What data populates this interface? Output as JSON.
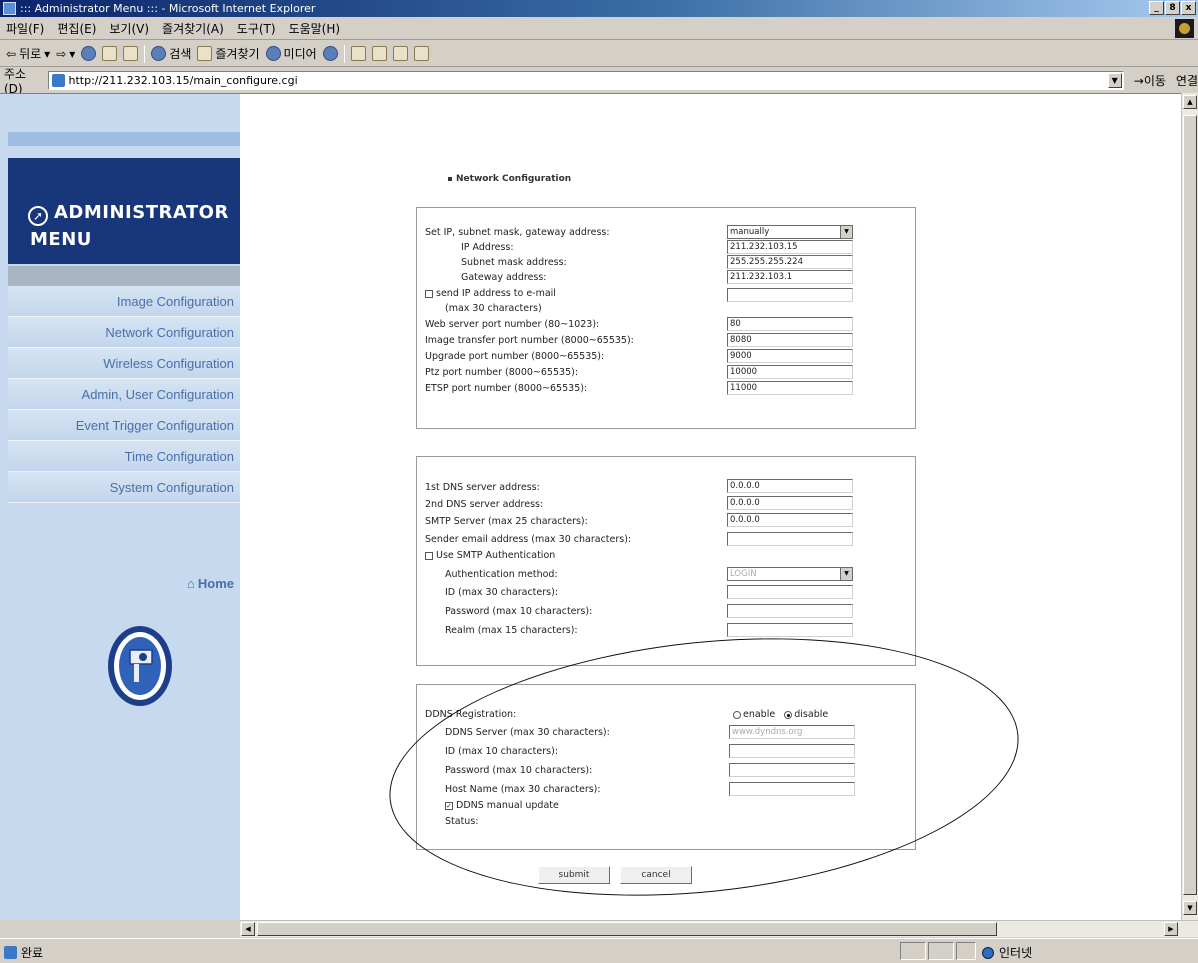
{
  "window": {
    "title": "::: Administrator Menu ::: - Microsoft Internet Explorer",
    "buttons": [
      "_",
      "8",
      "x"
    ]
  },
  "menubar": {
    "items": [
      "파일(F)",
      "편집(E)",
      "보기(V)",
      "즐겨찾기(A)",
      "도구(T)",
      "도움말(H)"
    ]
  },
  "toolbar": {
    "back": "뒤로",
    "search": "검색",
    "favorites": "즐겨찾기",
    "media": "미디어"
  },
  "address": {
    "label": "주소(D)",
    "url": "http://211.232.103.15/main_configure.cgi",
    "go": "이동",
    "links": "연결"
  },
  "sidebar": {
    "header_line1": "ADMINISTRATOR",
    "header_line2": "MENU",
    "items": [
      {
        "label": "Image Configuration"
      },
      {
        "label": "Network Configuration"
      },
      {
        "label": "Wireless Configuration"
      },
      {
        "label": "Admin, User Configuration"
      },
      {
        "label": "Event Trigger Configuration"
      },
      {
        "label": "Time Configuration"
      },
      {
        "label": "System Configuration"
      }
    ],
    "home": "Home"
  },
  "network": {
    "section_title": "Network Configuration",
    "set_ip_label": "Set IP, subnet mask, gateway address:",
    "set_ip_mode": "manually",
    "ip_label": "IP Address:",
    "ip_value": "211.232.103.15",
    "subnet_label": "Subnet mask address:",
    "subnet_value": "255.255.255.224",
    "gateway_label": "Gateway address:",
    "gateway_value": "211.232.103.1",
    "send_ip_label": "send IP address to e-mail",
    "send_ip_note": "(max 30 characters)",
    "web_port_label": "Web server port number (80~1023):",
    "web_port_value": "80",
    "image_port_label": "Image transfer port number (8000~65535):",
    "image_port_value": "8080",
    "upgrade_port_label": "Upgrade port number (8000~65535):",
    "upgrade_port_value": "9000",
    "ptz_port_label": "Ptz port number (8000~65535):",
    "ptz_port_value": "10000",
    "etsp_port_label": "ETSP port number (8000~65535):",
    "etsp_port_value": "11000"
  },
  "dns": {
    "dns1_label": "1st DNS server address:",
    "dns1_value": "0.0.0.0",
    "dns2_label": "2nd DNS server address:",
    "dns2_value": "0.0.0.0",
    "smtp_label": "SMTP Server (max 25 characters):",
    "smtp_value": "0.0.0.0",
    "sender_label": "Sender email address (max 30 characters):",
    "sender_value": "",
    "use_auth_label": "Use SMTP Authentication",
    "auth_method_label": "Authentication method:",
    "auth_method_value": "LOGIN",
    "id_label": "ID (max 30 characters):",
    "password_label": "Password (max 10 characters):",
    "realm_label": "Realm (max 15 characters):"
  },
  "ddns": {
    "registration_label": "DDNS Registration:",
    "enable_label": "enable",
    "disable_label": "disable",
    "server_label": "DDNS Server (max 30 characters):",
    "server_value": "www.dyndns.org",
    "id_label": "ID (max 10 characters):",
    "password_label": "Password (max 10 characters):",
    "host_label": "Host Name (max 30 characters):",
    "manual_update_label": "DDNS manual update",
    "status_label": "Status:"
  },
  "buttons": {
    "submit": "submit",
    "cancel": "cancel"
  },
  "status": {
    "left": "완료",
    "zone": "인터넷"
  }
}
